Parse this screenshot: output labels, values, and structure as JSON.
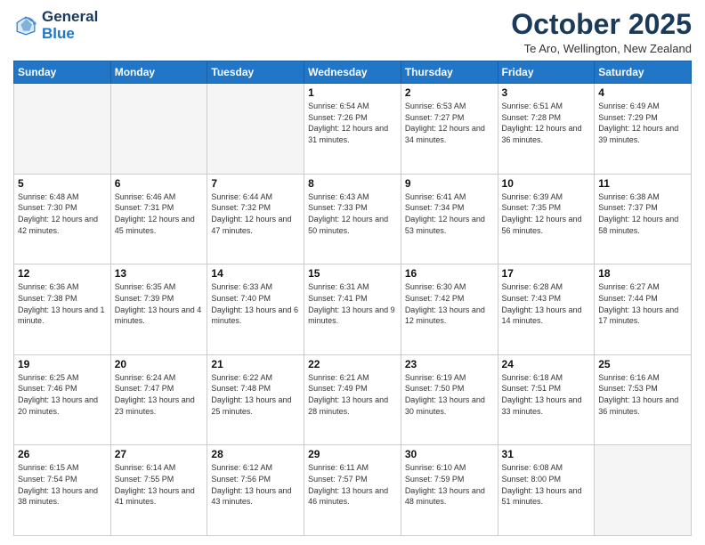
{
  "header": {
    "logo_line1": "General",
    "logo_line2": "Blue",
    "title": "October 2025",
    "location": "Te Aro, Wellington, New Zealand"
  },
  "days_of_week": [
    "Sunday",
    "Monday",
    "Tuesday",
    "Wednesday",
    "Thursday",
    "Friday",
    "Saturday"
  ],
  "weeks": [
    [
      {
        "day": "",
        "info": ""
      },
      {
        "day": "",
        "info": ""
      },
      {
        "day": "",
        "info": ""
      },
      {
        "day": "1",
        "info": "Sunrise: 6:54 AM\nSunset: 7:26 PM\nDaylight: 12 hours and 31 minutes."
      },
      {
        "day": "2",
        "info": "Sunrise: 6:53 AM\nSunset: 7:27 PM\nDaylight: 12 hours and 34 minutes."
      },
      {
        "day": "3",
        "info": "Sunrise: 6:51 AM\nSunset: 7:28 PM\nDaylight: 12 hours and 36 minutes."
      },
      {
        "day": "4",
        "info": "Sunrise: 6:49 AM\nSunset: 7:29 PM\nDaylight: 12 hours and 39 minutes."
      }
    ],
    [
      {
        "day": "5",
        "info": "Sunrise: 6:48 AM\nSunset: 7:30 PM\nDaylight: 12 hours and 42 minutes."
      },
      {
        "day": "6",
        "info": "Sunrise: 6:46 AM\nSunset: 7:31 PM\nDaylight: 12 hours and 45 minutes."
      },
      {
        "day": "7",
        "info": "Sunrise: 6:44 AM\nSunset: 7:32 PM\nDaylight: 12 hours and 47 minutes."
      },
      {
        "day": "8",
        "info": "Sunrise: 6:43 AM\nSunset: 7:33 PM\nDaylight: 12 hours and 50 minutes."
      },
      {
        "day": "9",
        "info": "Sunrise: 6:41 AM\nSunset: 7:34 PM\nDaylight: 12 hours and 53 minutes."
      },
      {
        "day": "10",
        "info": "Sunrise: 6:39 AM\nSunset: 7:35 PM\nDaylight: 12 hours and 56 minutes."
      },
      {
        "day": "11",
        "info": "Sunrise: 6:38 AM\nSunset: 7:37 PM\nDaylight: 12 hours and 58 minutes."
      }
    ],
    [
      {
        "day": "12",
        "info": "Sunrise: 6:36 AM\nSunset: 7:38 PM\nDaylight: 13 hours and 1 minute."
      },
      {
        "day": "13",
        "info": "Sunrise: 6:35 AM\nSunset: 7:39 PM\nDaylight: 13 hours and 4 minutes."
      },
      {
        "day": "14",
        "info": "Sunrise: 6:33 AM\nSunset: 7:40 PM\nDaylight: 13 hours and 6 minutes."
      },
      {
        "day": "15",
        "info": "Sunrise: 6:31 AM\nSunset: 7:41 PM\nDaylight: 13 hours and 9 minutes."
      },
      {
        "day": "16",
        "info": "Sunrise: 6:30 AM\nSunset: 7:42 PM\nDaylight: 13 hours and 12 minutes."
      },
      {
        "day": "17",
        "info": "Sunrise: 6:28 AM\nSunset: 7:43 PM\nDaylight: 13 hours and 14 minutes."
      },
      {
        "day": "18",
        "info": "Sunrise: 6:27 AM\nSunset: 7:44 PM\nDaylight: 13 hours and 17 minutes."
      }
    ],
    [
      {
        "day": "19",
        "info": "Sunrise: 6:25 AM\nSunset: 7:46 PM\nDaylight: 13 hours and 20 minutes."
      },
      {
        "day": "20",
        "info": "Sunrise: 6:24 AM\nSunset: 7:47 PM\nDaylight: 13 hours and 23 minutes."
      },
      {
        "day": "21",
        "info": "Sunrise: 6:22 AM\nSunset: 7:48 PM\nDaylight: 13 hours and 25 minutes."
      },
      {
        "day": "22",
        "info": "Sunrise: 6:21 AM\nSunset: 7:49 PM\nDaylight: 13 hours and 28 minutes."
      },
      {
        "day": "23",
        "info": "Sunrise: 6:19 AM\nSunset: 7:50 PM\nDaylight: 13 hours and 30 minutes."
      },
      {
        "day": "24",
        "info": "Sunrise: 6:18 AM\nSunset: 7:51 PM\nDaylight: 13 hours and 33 minutes."
      },
      {
        "day": "25",
        "info": "Sunrise: 6:16 AM\nSunset: 7:53 PM\nDaylight: 13 hours and 36 minutes."
      }
    ],
    [
      {
        "day": "26",
        "info": "Sunrise: 6:15 AM\nSunset: 7:54 PM\nDaylight: 13 hours and 38 minutes."
      },
      {
        "day": "27",
        "info": "Sunrise: 6:14 AM\nSunset: 7:55 PM\nDaylight: 13 hours and 41 minutes."
      },
      {
        "day": "28",
        "info": "Sunrise: 6:12 AM\nSunset: 7:56 PM\nDaylight: 13 hours and 43 minutes."
      },
      {
        "day": "29",
        "info": "Sunrise: 6:11 AM\nSunset: 7:57 PM\nDaylight: 13 hours and 46 minutes."
      },
      {
        "day": "30",
        "info": "Sunrise: 6:10 AM\nSunset: 7:59 PM\nDaylight: 13 hours and 48 minutes."
      },
      {
        "day": "31",
        "info": "Sunrise: 6:08 AM\nSunset: 8:00 PM\nDaylight: 13 hours and 51 minutes."
      },
      {
        "day": "",
        "info": ""
      }
    ]
  ]
}
